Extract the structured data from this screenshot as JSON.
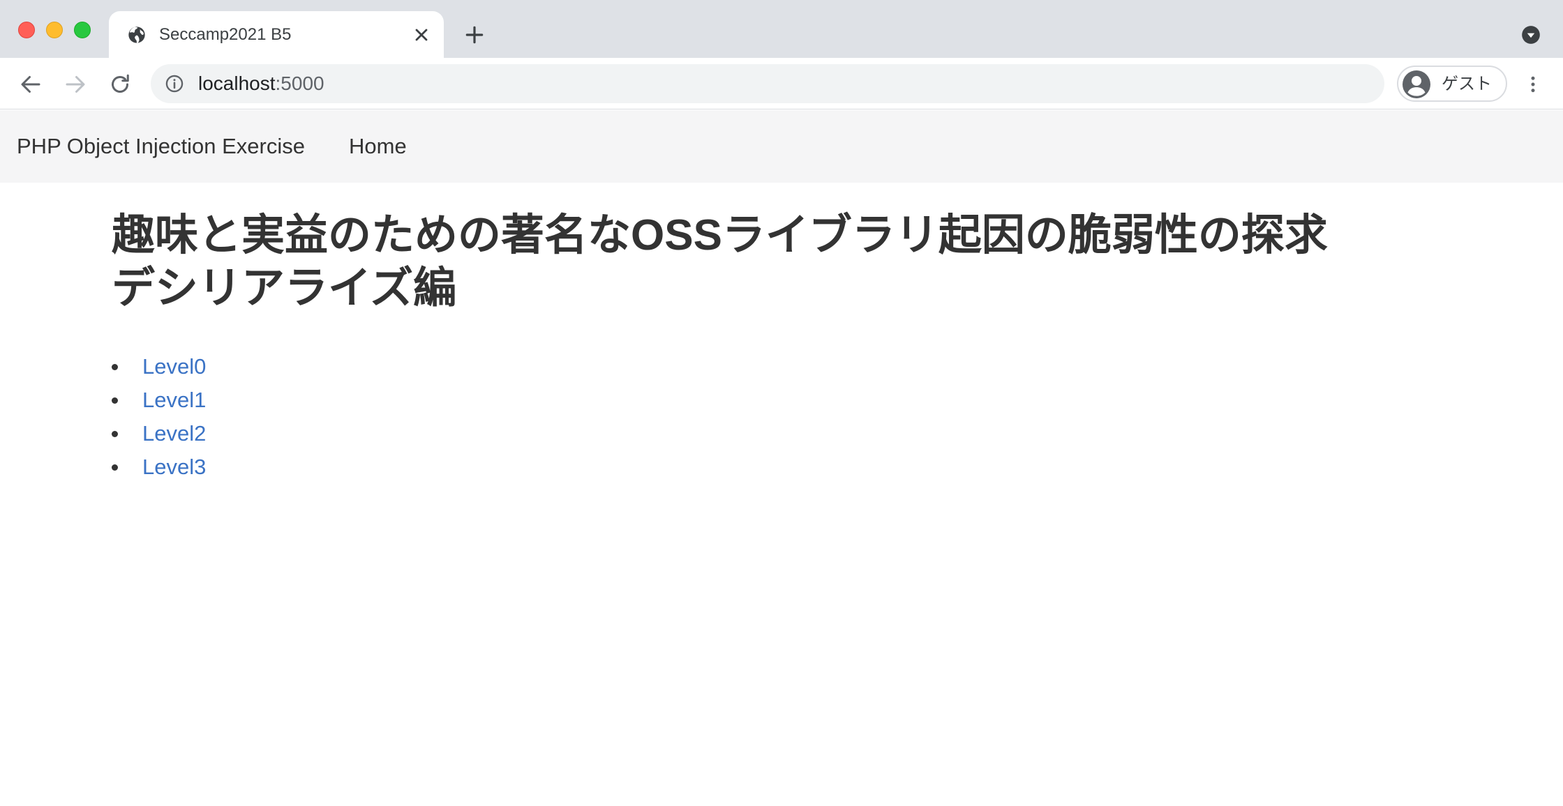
{
  "browser": {
    "tab": {
      "title": "Seccamp2021 B5",
      "favicon": "globe-icon"
    },
    "address_bar": {
      "host": "localhost",
      "port": ":5000"
    },
    "profile": {
      "label": "ゲスト"
    }
  },
  "navbar": {
    "brand": "PHP Object Injection Exercise",
    "links": [
      {
        "label": "Home"
      }
    ]
  },
  "main": {
    "title_line1": "趣味と実益のための著名なOSSライブラリ起因の脆弱性の探求",
    "title_line2": "デシリアライズ編",
    "levels": [
      {
        "label": "Level0"
      },
      {
        "label": "Level1"
      },
      {
        "label": "Level2"
      },
      {
        "label": "Level3"
      }
    ]
  },
  "colors": {
    "link": "#3b73c5",
    "text": "#333333",
    "navbar_bg": "#f5f5f6",
    "tabstrip_bg": "#dee1e6"
  }
}
